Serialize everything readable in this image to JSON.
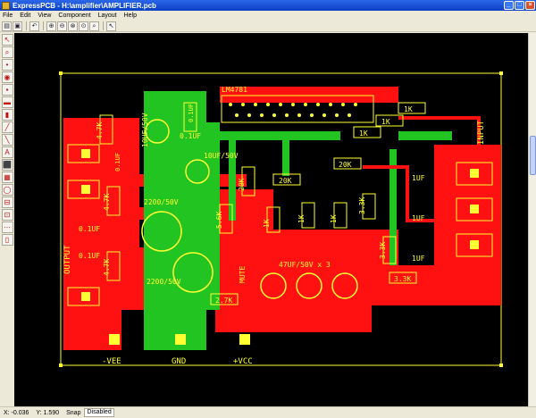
{
  "window": {
    "title": "ExpressPCB - H:\\amplifier\\AMPLIFIER.pcb",
    "minimize": "_",
    "maximize": "□",
    "close": "×"
  },
  "menu": [
    "File",
    "Edit",
    "View",
    "Component",
    "Layout",
    "Help"
  ],
  "toolbar": {
    "icons": [
      "open-icon",
      "save-icon",
      "undo-icon",
      "zoom-in-icon",
      "zoom-out-icon",
      "zoom-fit-icon",
      "zoom-area-icon",
      "zoom-window-icon",
      "pointer-icon"
    ],
    "glyphs": [
      "▤",
      "▣",
      "↶",
      "⊕",
      "⊖",
      "⊗",
      "⊙",
      "⌕",
      "↖"
    ]
  },
  "lefttools": {
    "glyphs": [
      "↖",
      "⌕",
      "•",
      "◉",
      "▪",
      "▬",
      "▮",
      "╱",
      "╲",
      "A",
      "⬛",
      "▦",
      "◯",
      "⊟",
      "⊡",
      "⋯",
      "▯"
    ]
  },
  "status": {
    "x": "X: -0.036",
    "y": "Y: 1.590",
    "snap_label": "Snap",
    "snap_value": "Disabled"
  },
  "board": {
    "chip": "LM4781",
    "resistors": [
      "4.7K",
      "4.7K",
      "4.7K",
      "1K",
      "1K",
      "1K",
      "1K",
      "1K",
      "1K",
      "20K",
      "20K",
      "20K",
      "5.6K",
      "3.3K",
      "3.3K",
      "3.3K",
      "2.7K"
    ],
    "caps": [
      "10UF/50V",
      "0.1UF",
      "0.1UF",
      "10UF/50V",
      "0.1UF",
      "0.1UF",
      "0.1UF",
      "2200/50V",
      "2200/50V",
      "47UF/50V x 3",
      "1UF",
      "1UF",
      "1UF"
    ],
    "labels": {
      "output": "OUTPUT",
      "input": "INPUT",
      "vee": "-VEE",
      "gnd": "GND",
      "vcc": "+VCC",
      "mute": "MUTE"
    }
  },
  "colors": {
    "top_copper": "#ff1111",
    "bottom_copper": "#22c422",
    "silkscreen": "#ffff33",
    "background": "#000000",
    "pad": "#ffff33"
  }
}
